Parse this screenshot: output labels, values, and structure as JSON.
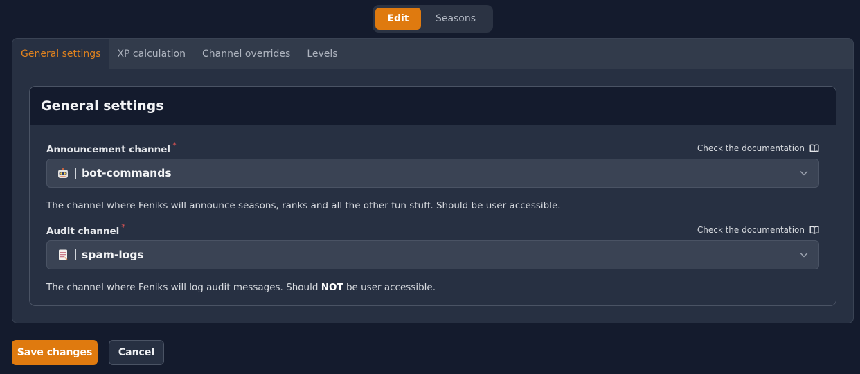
{
  "mode_switch": {
    "edit": "Edit",
    "seasons": "Seasons"
  },
  "tabs": [
    "General settings",
    "XP calculation",
    "Channel overrides",
    "Levels"
  ],
  "card": {
    "title": "General settings"
  },
  "fields": [
    {
      "label": "Announcement channel",
      "required_mark": "*",
      "doc_link": "Check the documentation",
      "icon": "robot-emoji-icon",
      "value": "bot-commands",
      "help": "The channel where Feniks will announce seasons, ranks and all the other fun stuff. Should be user accessible."
    },
    {
      "label": "Audit channel",
      "required_mark": "*",
      "doc_link": "Check the documentation",
      "icon": "memo-emoji-icon",
      "value": "spam-logs",
      "help_pre": "The channel where Feniks will log audit messages. Should ",
      "help_strong": "NOT",
      "help_post": " be user accessible."
    }
  ],
  "actions": {
    "save": "Save changes",
    "cancel": "Cancel"
  },
  "colors": {
    "accent": "#df7a0f",
    "background": "#141b2d",
    "panel": "#273042"
  }
}
